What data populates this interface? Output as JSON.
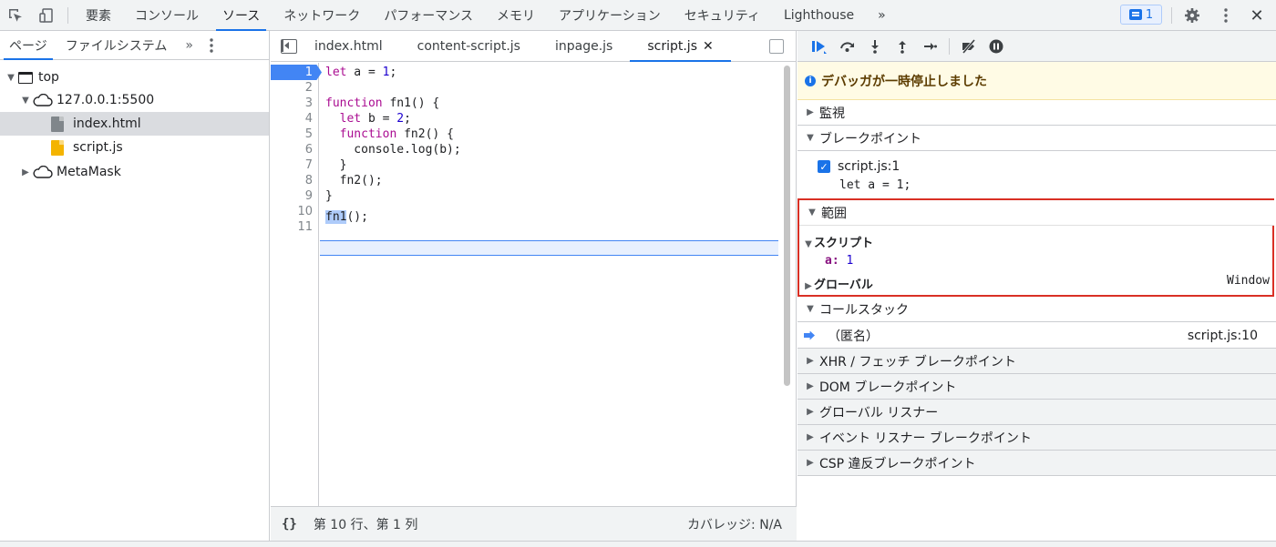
{
  "toolbar": {
    "tabs": [
      "要素",
      "コンソール",
      "ソース",
      "ネットワーク",
      "パフォーマンス",
      "メモリ",
      "アプリケーション",
      "セキュリティ",
      "Lighthouse"
    ],
    "more": "»",
    "issues_count": "1",
    "close": "✕"
  },
  "navigator": {
    "tabs": [
      "ページ",
      "ファイルシステム"
    ],
    "more": "»",
    "tree": {
      "top": "top",
      "origin": "127.0.0.1:5500",
      "file1": "index.html",
      "file2": "script.js",
      "ext": "MetaMask"
    }
  },
  "editor": {
    "tabs": [
      "index.html",
      "content-script.js",
      "inpage.js",
      "script.js"
    ],
    "close": "✕",
    "line_numbers": [
      "1",
      "2",
      "3",
      "4",
      "5",
      "6",
      "7",
      "8",
      "9",
      "10",
      "11"
    ],
    "code": {
      "l1_kw": "let",
      "l1_rest": " a = ",
      "l1_num": "1",
      "l1_end": ";",
      "l3_kw": "function",
      "l3_rest": " fn1() {",
      "l4_kw": "  let",
      "l4_rest": " b = ",
      "l4_num": "2",
      "l4_end": ";",
      "l5_kw": "  function",
      "l5_rest": " fn2() {",
      "l6": "    console.log(b);",
      "l7": "  }",
      "l8": "  fn2();",
      "l9": "}",
      "l10_hl": "fn1",
      "l10_rest": "();"
    },
    "status": {
      "braces": "{}",
      "position": "第 10 行、第 1 列",
      "coverage": "カバレッジ: N/A"
    }
  },
  "debugger": {
    "paused_message": "デバッガが一時停止しました",
    "sections": {
      "watch": "監視",
      "breakpoints": "ブレークポイント",
      "scope": "範囲",
      "callstack": "コールスタック",
      "xhr": "XHR / フェッチ ブレークポイント",
      "dom": "DOM ブレークポイント",
      "global_listeners": "グローバル リスナー",
      "event_listeners": "イベント リスナー ブレークポイント",
      "csp": "CSP 違反ブレークポイント"
    },
    "breakpoint": {
      "file": "script.js:1",
      "code": "let a = 1;"
    },
    "scope": {
      "script_label": "スクリプト",
      "var_name": "a",
      "var_value": "1",
      "global_label": "グローバル",
      "global_value": "Window"
    },
    "callstack": {
      "frame_name": "（匿名）",
      "frame_location": "script.js:10"
    }
  },
  "colors": {
    "accent": "#1a73e8",
    "scope_highlight": "#d93025",
    "paused_bg": "#fffbe5"
  }
}
